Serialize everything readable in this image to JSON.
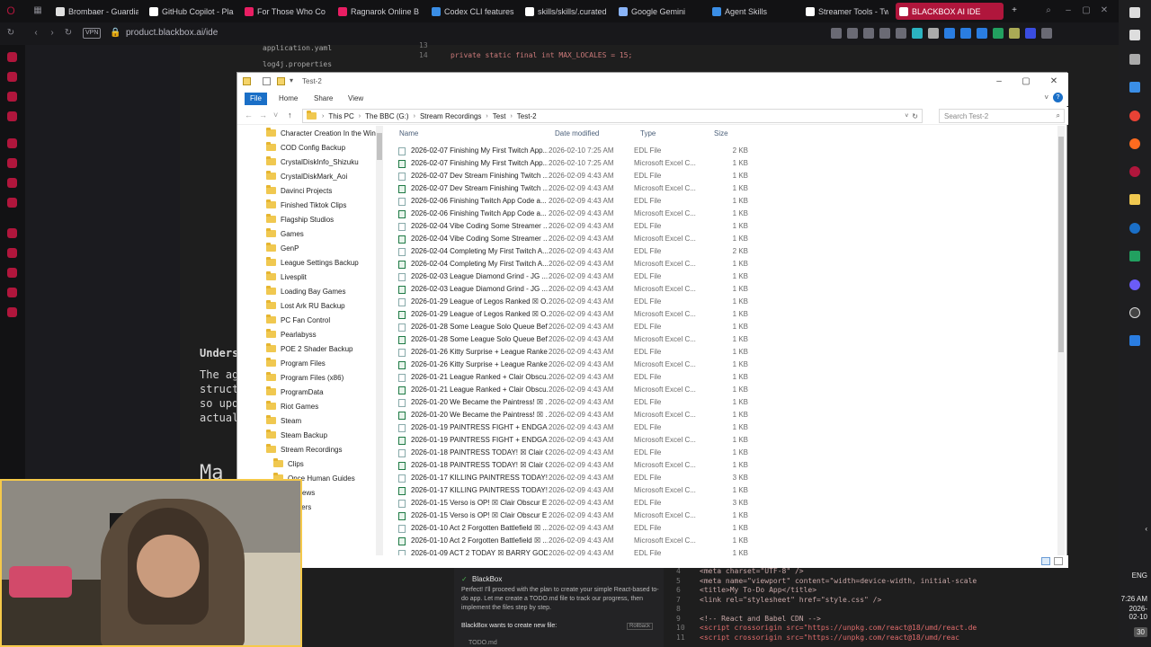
{
  "browser": {
    "tabs": [
      {
        "label": "Brombaer - Guardia",
        "color": "#e0e0e0"
      },
      {
        "label": "GitHub Copilot - Pla",
        "color": "#ffffff"
      },
      {
        "label": "For Those Who Co",
        "color": "#e91e63"
      },
      {
        "label": "Ragnarok Online B",
        "color": "#e91e63"
      },
      {
        "label": "Codex CLI features",
        "color": "#3a8ee6"
      },
      {
        "label": "skills/skills/.curated",
        "color": "#ffffff"
      },
      {
        "label": "Google Gemini",
        "color": "#8ab4f8"
      },
      {
        "label": "Agent Skills",
        "color": "#3a8ee6"
      },
      {
        "label": "Streamer Tools - Tw",
        "color": "#ffffff"
      },
      {
        "label": "BLACKBOX AI IDE",
        "color": "#ffffff"
      }
    ],
    "vpn_label": "VPN",
    "url": "product.blackbox.ai/ide",
    "accent": "#b0163c"
  },
  "ide": {
    "tree_items": [
      "application.yaml",
      "log4j.properties"
    ],
    "code_line_numbers": [
      "13",
      "14"
    ],
    "code_line": "private static final int MAX_LOCALES = 15;",
    "left_heading": "Unders",
    "left_text": [
      "The ag",
      "struct",
      "so upd",
      "actual"
    ],
    "left_heading2": "Ma",
    "right_code": [
      "<meta charset=\"UTF-8\" />",
      "<meta name=\"viewport\" content=\"width=device-width, initial-scale",
      "<title>My To-Do App</title>",
      "<link rel=\"stylesheet\" href=\"style.css\" />",
      "",
      "<!-- React and Babel CDN -->",
      "<script crossorigin src=\"https://unpkg.com/react@18/umd/react.de",
      "<script crossorigin src=\"https://unpkg.com/react@18/umd/reac"
    ],
    "right_line_numbers": [
      "4",
      "5",
      "6",
      "7",
      "8",
      "9",
      "10",
      "11"
    ]
  },
  "chat": {
    "sender": "BlackBox",
    "message": "Perfect! I'll proceed with the plan to create your simple React-based to-do app. Let me create a TODO.md file to track our progress, then implement the files step by step.",
    "wants": "BlackBox wants to create new file:",
    "rollback": "Rollback",
    "file": "TODO.md"
  },
  "explorer": {
    "title": "Test-2",
    "ribbon_tabs": [
      "File",
      "Home",
      "Share",
      "View"
    ],
    "breadcrumb": [
      "This PC",
      "The BBC (G:)",
      "Stream Recordings",
      "Test",
      "Test-2"
    ],
    "search_placeholder": "Search Test-2",
    "nav_items": [
      "Character Creation In the Wind",
      "COD Config Backup",
      "CrystalDiskInfo_Shizuku",
      "CrystalDiskMark_Aoi",
      "Davinci Projects",
      "Finished Tiktok Clips",
      "Flagship Studios",
      "Games",
      "GenP",
      "League Settings Backup",
      "Livesplit",
      "Loading Bay Games",
      "Lost Ark RU Backup",
      "PC Fan Control",
      "Pearlabyss",
      "POE 2 Shader Backup",
      "Program Files",
      "Program Files (x86)",
      "ProgramData",
      "Riot Games",
      "Steam",
      "Steam Backup",
      "Stream Recordings"
    ],
    "nav_sub_items": [
      "Clips",
      "Once Human Guides",
      "Reviews",
      "Makers"
    ],
    "columns": {
      "name": "Name",
      "date": "Date modified",
      "type": "Type",
      "size": "Size"
    },
    "files": [
      {
        "name": "2026-02-07 Finishing My First Twitch App...",
        "date": "2026-02-10 7:25 AM",
        "type": "EDL File",
        "size": "2 KB",
        "kind": "edl"
      },
      {
        "name": "2026-02-07 Finishing My First Twitch App...",
        "date": "2026-02-10 7:25 AM",
        "type": "Microsoft Excel C...",
        "size": "1 KB",
        "kind": "xls"
      },
      {
        "name": "2026-02-07 Dev Stream Finishing Twitch ...",
        "date": "2026-02-09 4:43 AM",
        "type": "EDL File",
        "size": "1 KB",
        "kind": "edl"
      },
      {
        "name": "2026-02-07 Dev Stream Finishing Twitch ...",
        "date": "2026-02-09 4:43 AM",
        "type": "Microsoft Excel C...",
        "size": "1 KB",
        "kind": "xls"
      },
      {
        "name": "2026-02-06 Finishing Twitch App Code a...",
        "date": "2026-02-09 4:43 AM",
        "type": "EDL File",
        "size": "1 KB",
        "kind": "edl"
      },
      {
        "name": "2026-02-06 Finishing Twitch App Code a...",
        "date": "2026-02-09 4:43 AM",
        "type": "Microsoft Excel C...",
        "size": "1 KB",
        "kind": "xls"
      },
      {
        "name": "2026-02-04 Vibe Coding Some Streamer ...",
        "date": "2026-02-09 4:43 AM",
        "type": "EDL File",
        "size": "1 KB",
        "kind": "edl"
      },
      {
        "name": "2026-02-04 Vibe Coding Some Streamer ...",
        "date": "2026-02-09 4:43 AM",
        "type": "Microsoft Excel C...",
        "size": "1 KB",
        "kind": "xls"
      },
      {
        "name": "2026-02-04 Completing My First Twitch A...",
        "date": "2026-02-09 4:43 AM",
        "type": "EDL File",
        "size": "2 KB",
        "kind": "edl"
      },
      {
        "name": "2026-02-04 Completing My First Twitch A...",
        "date": "2026-02-09 4:43 AM",
        "type": "Microsoft Excel C...",
        "size": "1 KB",
        "kind": "xls"
      },
      {
        "name": "2026-02-03 League Diamond Grind - JG ...",
        "date": "2026-02-09 4:43 AM",
        "type": "EDL File",
        "size": "1 KB",
        "kind": "edl"
      },
      {
        "name": "2026-02-03 League Diamond Grind - JG ...",
        "date": "2026-02-09 4:43 AM",
        "type": "Microsoft Excel C...",
        "size": "1 KB",
        "kind": "xls"
      },
      {
        "name": "2026-01-29 League of Legos Ranked ☒ O...",
        "date": "2026-02-09 4:43 AM",
        "type": "EDL File",
        "size": "1 KB",
        "kind": "edl"
      },
      {
        "name": "2026-01-29 League of Legos Ranked ☒ O...",
        "date": "2026-02-09 4:43 AM",
        "type": "Microsoft Excel C...",
        "size": "1 KB",
        "kind": "xls"
      },
      {
        "name": "2026-01-28 Some League Solo Queue Bef...",
        "date": "2026-02-09 4:43 AM",
        "type": "EDL File",
        "size": "1 KB",
        "kind": "edl"
      },
      {
        "name": "2026-01-28 Some League Solo Queue Bef...",
        "date": "2026-02-09 4:43 AM",
        "type": "Microsoft Excel C...",
        "size": "1 KB",
        "kind": "xls"
      },
      {
        "name": "2026-01-26 Kitty Surprise + League Ranke...",
        "date": "2026-02-09 4:43 AM",
        "type": "EDL File",
        "size": "1 KB",
        "kind": "edl"
      },
      {
        "name": "2026-01-26 Kitty Surprise + League Ranke...",
        "date": "2026-02-09 4:43 AM",
        "type": "Microsoft Excel C...",
        "size": "1 KB",
        "kind": "xls"
      },
      {
        "name": "2026-01-21 League Ranked + Clair Obscu...",
        "date": "2026-02-09 4:43 AM",
        "type": "EDL File",
        "size": "1 KB",
        "kind": "edl"
      },
      {
        "name": "2026-01-21 League Ranked + Clair Obscu...",
        "date": "2026-02-09 4:43 AM",
        "type": "Microsoft Excel C...",
        "size": "1 KB",
        "kind": "xls"
      },
      {
        "name": "2026-01-20 We Became the Paintress! ☒ ...",
        "date": "2026-02-09 4:43 AM",
        "type": "EDL File",
        "size": "1 KB",
        "kind": "edl"
      },
      {
        "name": "2026-01-20 We Became the Paintress! ☒ ...",
        "date": "2026-02-09 4:43 AM",
        "type": "Microsoft Excel C...",
        "size": "1 KB",
        "kind": "xls"
      },
      {
        "name": "2026-01-19 PAINTRESS FIGHT + ENDGAM...",
        "date": "2026-02-09 4:43 AM",
        "type": "EDL File",
        "size": "1 KB",
        "kind": "edl"
      },
      {
        "name": "2026-01-19 PAINTRESS FIGHT + ENDGAM...",
        "date": "2026-02-09 4:43 AM",
        "type": "Microsoft Excel C...",
        "size": "1 KB",
        "kind": "xls"
      },
      {
        "name": "2026-01-18 PAINTRESS TODAY! ☒ Clair O...",
        "date": "2026-02-09 4:43 AM",
        "type": "EDL File",
        "size": "1 KB",
        "kind": "edl"
      },
      {
        "name": "2026-01-18 PAINTRESS TODAY! ☒ Clair O...",
        "date": "2026-02-09 4:43 AM",
        "type": "Microsoft Excel C...",
        "size": "1 KB",
        "kind": "xls"
      },
      {
        "name": "2026-01-17 KILLING PAINTRESS TODAY! ...",
        "date": "2026-02-09 4:43 AM",
        "type": "EDL File",
        "size": "3 KB",
        "kind": "edl"
      },
      {
        "name": "2026-01-17 KILLING PAINTRESS TODAY! ...",
        "date": "2026-02-09 4:43 AM",
        "type": "Microsoft Excel C...",
        "size": "1 KB",
        "kind": "xls"
      },
      {
        "name": "2026-01-15 Verso is OP! ☒ Clair Obscur E...",
        "date": "2026-02-09 4:43 AM",
        "type": "EDL File",
        "size": "3 KB",
        "kind": "edl"
      },
      {
        "name": "2026-01-15 Verso is OP! ☒ Clair Obscur E...",
        "date": "2026-02-09 4:43 AM",
        "type": "Microsoft Excel C...",
        "size": "1 KB",
        "kind": "xls"
      },
      {
        "name": "2026-01-10 Act 2 Forgotten Battlefield ☒ ...",
        "date": "2026-02-09 4:43 AM",
        "type": "EDL File",
        "size": "1 KB",
        "kind": "edl"
      },
      {
        "name": "2026-01-10 Act 2 Forgotten Battlefield ☒ ...",
        "date": "2026-02-09 4:43 AM",
        "type": "Microsoft Excel C...",
        "size": "1 KB",
        "kind": "xls"
      },
      {
        "name": "2026-01-09 ACT 2 TODAY ☒ BARRY GOD...",
        "date": "2026-02-09 4:43 AM",
        "type": "EDL File",
        "size": "1 KB",
        "kind": "edl"
      }
    ]
  },
  "taskbar": {
    "lang": "ENG",
    "time": "7:26 AM",
    "date": "2026-02-10",
    "notif": "30"
  }
}
